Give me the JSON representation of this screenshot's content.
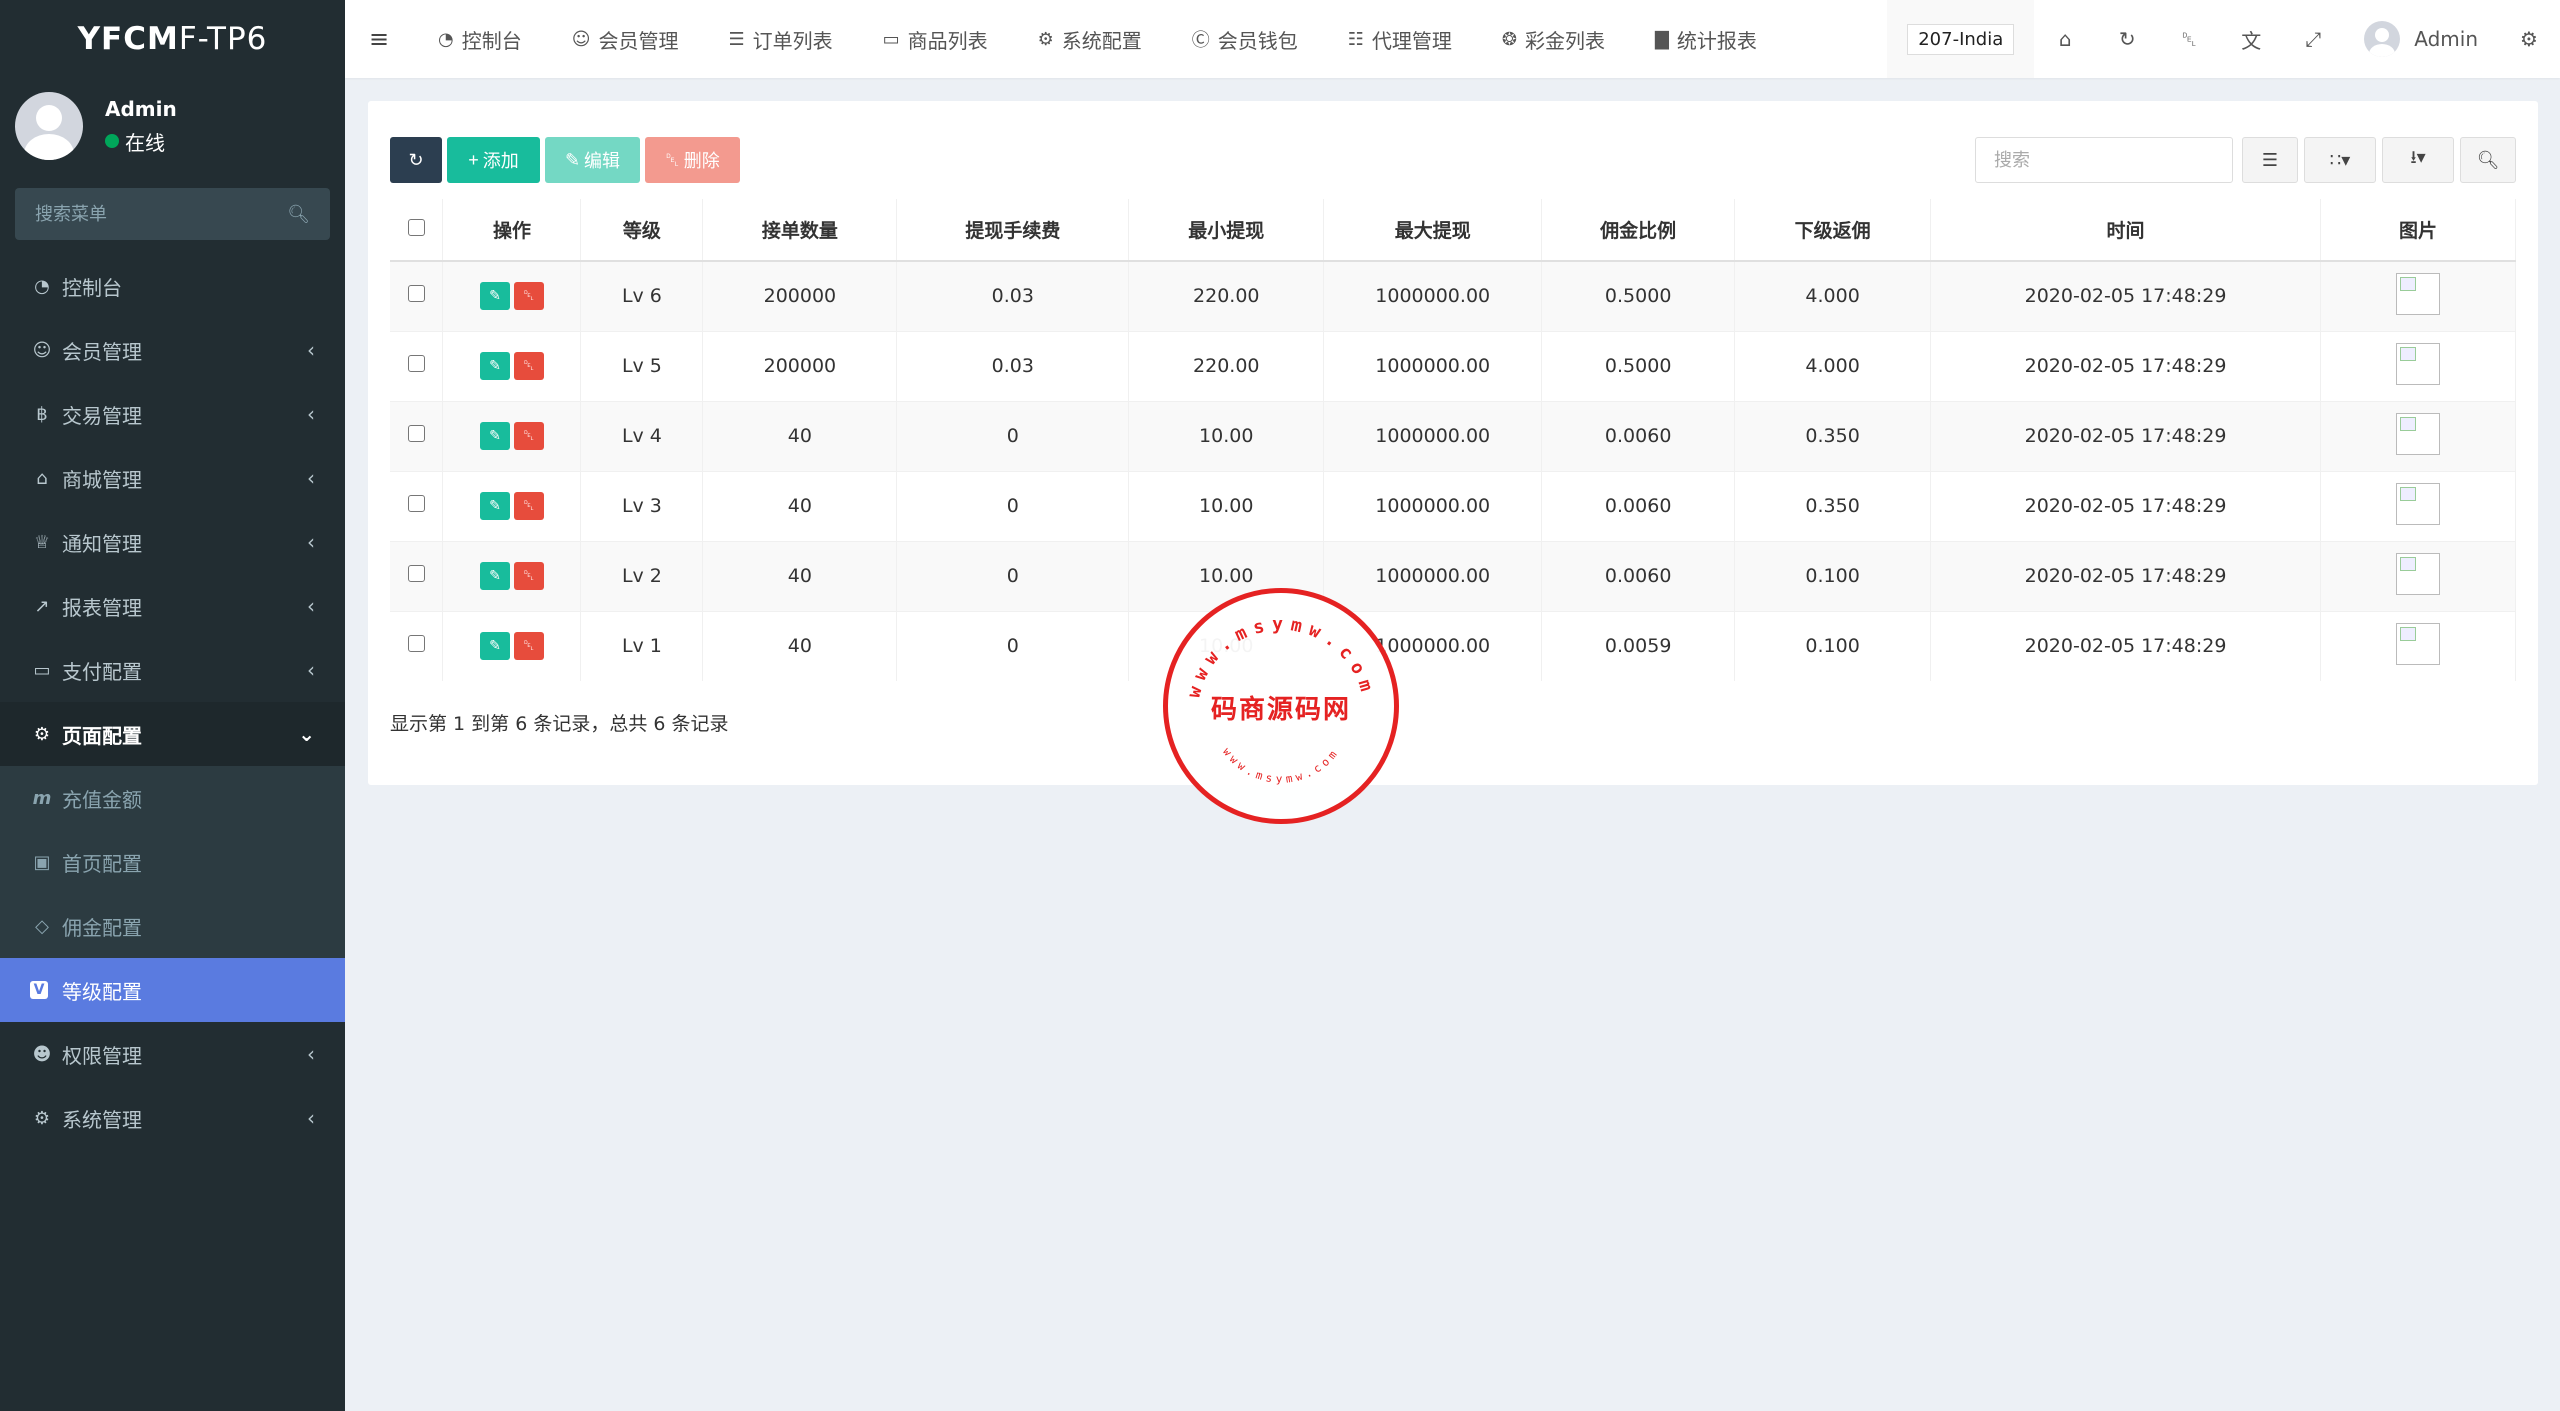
{
  "app": {
    "logo_bold": "YFCM",
    "logo_rest": "F-TP6"
  },
  "user": {
    "name": "Admin",
    "status": "在线"
  },
  "sidebar": {
    "search_placeholder": "搜索菜单",
    "items": [
      {
        "label": "控制台",
        "icon": "dashboard-icon"
      },
      {
        "label": "会员管理",
        "icon": "user-icon"
      },
      {
        "label": "交易管理",
        "icon": "bitcoin-icon"
      },
      {
        "label": "商城管理",
        "icon": "home-icon"
      },
      {
        "label": "通知管理",
        "icon": "bell-icon"
      },
      {
        "label": "报表管理",
        "icon": "line-chart-icon"
      },
      {
        "label": "支付配置",
        "icon": "credit-card-icon"
      },
      {
        "label": "页面配置",
        "icon": "gear-icon"
      }
    ],
    "sub_items": [
      {
        "label": "充值金额",
        "icon": "m-icon"
      },
      {
        "label": "首页配置",
        "icon": "square-icon"
      },
      {
        "label": "佣金配置",
        "icon": "diamond-icon"
      },
      {
        "label": "等级配置",
        "icon": "v-icon"
      }
    ],
    "after_items": [
      {
        "label": "权限管理",
        "icon": "users-icon"
      },
      {
        "label": "系统管理",
        "icon": "cogs-icon"
      }
    ]
  },
  "topnav": {
    "links": [
      {
        "label": "控制台",
        "icon": "dashboard-icon"
      },
      {
        "label": "会员管理",
        "icon": "user-icon"
      },
      {
        "label": "订单列表",
        "icon": "list-icon"
      },
      {
        "label": "商品列表",
        "icon": "desktop-icon"
      },
      {
        "label": "系统配置",
        "icon": "gear-icon"
      },
      {
        "label": "会员钱包",
        "icon": "cc-icon"
      },
      {
        "label": "代理管理",
        "icon": "sitemap-icon"
      },
      {
        "label": "彩金列表",
        "icon": "gift-icon"
      },
      {
        "label": "统计报表",
        "icon": "bar-chart-icon"
      }
    ],
    "country": "207-India",
    "user_name": "Admin"
  },
  "toolbar": {
    "add": "添加",
    "edit": "编辑",
    "delete": "删除",
    "search_placeholder": "搜索"
  },
  "table": {
    "headers": [
      "操作",
      "等级",
      "接单数量",
      "提现手续费",
      "最小提现",
      "最大提现",
      "佣金比例",
      "下级返佣",
      "时间",
      "图片"
    ],
    "rows": [
      {
        "level": "Lv 6",
        "orders": "200000",
        "fee": "0.03",
        "min": "220.00",
        "max": "1000000.00",
        "rate": "0.5000",
        "rebate": "4.000",
        "time": "2020-02-05 17:48:29"
      },
      {
        "level": "Lv 5",
        "orders": "200000",
        "fee": "0.03",
        "min": "220.00",
        "max": "1000000.00",
        "rate": "0.5000",
        "rebate": "4.000",
        "time": "2020-02-05 17:48:29"
      },
      {
        "level": "Lv 4",
        "orders": "40",
        "fee": "0",
        "min": "10.00",
        "max": "1000000.00",
        "rate": "0.0060",
        "rebate": "0.350",
        "time": "2020-02-05 17:48:29"
      },
      {
        "level": "Lv 3",
        "orders": "40",
        "fee": "0",
        "min": "10.00",
        "max": "1000000.00",
        "rate": "0.0060",
        "rebate": "0.350",
        "time": "2020-02-05 17:48:29"
      },
      {
        "level": "Lv 2",
        "orders": "40",
        "fee": "0",
        "min": "10.00",
        "max": "1000000.00",
        "rate": "0.0060",
        "rebate": "0.100",
        "time": "2020-02-05 17:48:29"
      },
      {
        "level": "Lv 1",
        "orders": "40",
        "fee": "0",
        "min": "10.00",
        "max": "1000000.00",
        "rate": "0.0059",
        "rebate": "0.100",
        "time": "2020-02-05 17:48:29"
      }
    ]
  },
  "pagination": {
    "info": "显示第 1 到第 6 条记录，总共 6 条记录"
  },
  "stamp": {
    "main": "码商源码网",
    "url_top": "www.msymw.com",
    "url_bottom": "www.msymw.com",
    "color": "#e52222"
  }
}
